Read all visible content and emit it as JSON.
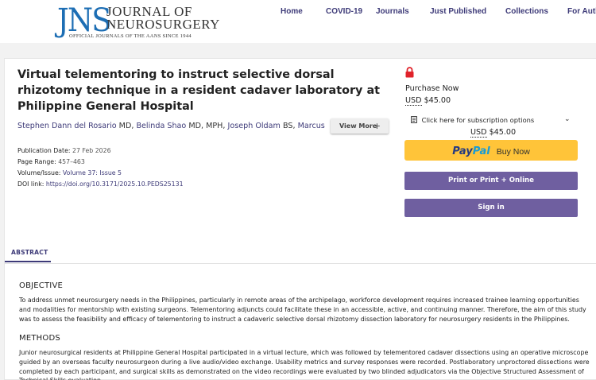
{
  "header": {
    "logo": {
      "jns": "JNS",
      "line1": "JOURNAL OF",
      "line2": "NEUROSURGERY",
      "line3": "OFFICIAL JOURNALS OF THE AANS SINCE 1944"
    },
    "nav": [
      "Home",
      "COVID-19",
      "Journals",
      "Just Published",
      "Collections",
      "For Auth"
    ]
  },
  "article": {
    "title": "Virtual telementoring to instruct selective dorsal rhizotomy technique in a resident cadaver laboratory at Philippine General Hospital",
    "authors": [
      {
        "name": "Stephen Dann del Rosario",
        "cred": "MD,"
      },
      {
        "name": "Belinda Shao",
        "cred": "MD, MPH,"
      },
      {
        "name": "Joseph Oldam",
        "cred": "BS,"
      },
      {
        "name": "Marcus Alex...",
        "cred": ""
      }
    ],
    "view_more": "View More",
    "meta": {
      "pub_label": "Publication Date:",
      "pub_value": "27 Feb 2026",
      "range_label": "Page Range:",
      "range_value": "457–463",
      "vol_label": "Volume/Issue:",
      "vol_value": "Volume 37: Issue 5",
      "doi_label": "DOI link:",
      "doi_value": "https://doi.org/10.3171/2025.10.PEDS25131"
    }
  },
  "purchase": {
    "purchase_now": "Purchase Now",
    "currency": "USD",
    "price": "$45.00",
    "subscription": "Click here for subscription options",
    "paypal_pay": "Pay",
    "paypal_pal": "Pal",
    "paypal_buy": "Buy Now",
    "print_label": "Print or Print + Online",
    "signin_label": "Sign in",
    "colors": {
      "paypal": "#ffc439",
      "button": "#6f5fa0"
    }
  },
  "tabs": {
    "abstract": "ABSTRACT"
  },
  "abstract": {
    "objective_h": "OBJECTIVE",
    "objective_p": "To address unmet neurosurgery needs in the Philippines, particularly in remote areas of the archipelago, workforce development requires increased trainee learning opportunities and modalities for mentorship with existing surgeons. Telementoring adjuncts could facilitate these in an accessible, active, and continuing manner. Therefore, the aim of this study was to assess the feasibility and efficacy of telementoring to instruct a cadaveric selective dorsal rhizotomy dissection laboratory for neurosurgery residents in the Philippines.",
    "methods_h": "METHODS",
    "methods_p": "Junior neurosurgical residents at Philippine General Hospital participated in a virtual lecture, which was followed by telementored cadaver dissections using an operative microscope guided by an overseas faculty neurosurgeon during a live audio/video exchange. Usability metrics and survey responses were recorded. Postlaboratory unproctored dissections were completed by each participant, and surgical skills as demonstrated on the video recordings were evaluated by two blinded adjudicators via the Objective Structured Assessment of Technical Skills evaluation."
  }
}
